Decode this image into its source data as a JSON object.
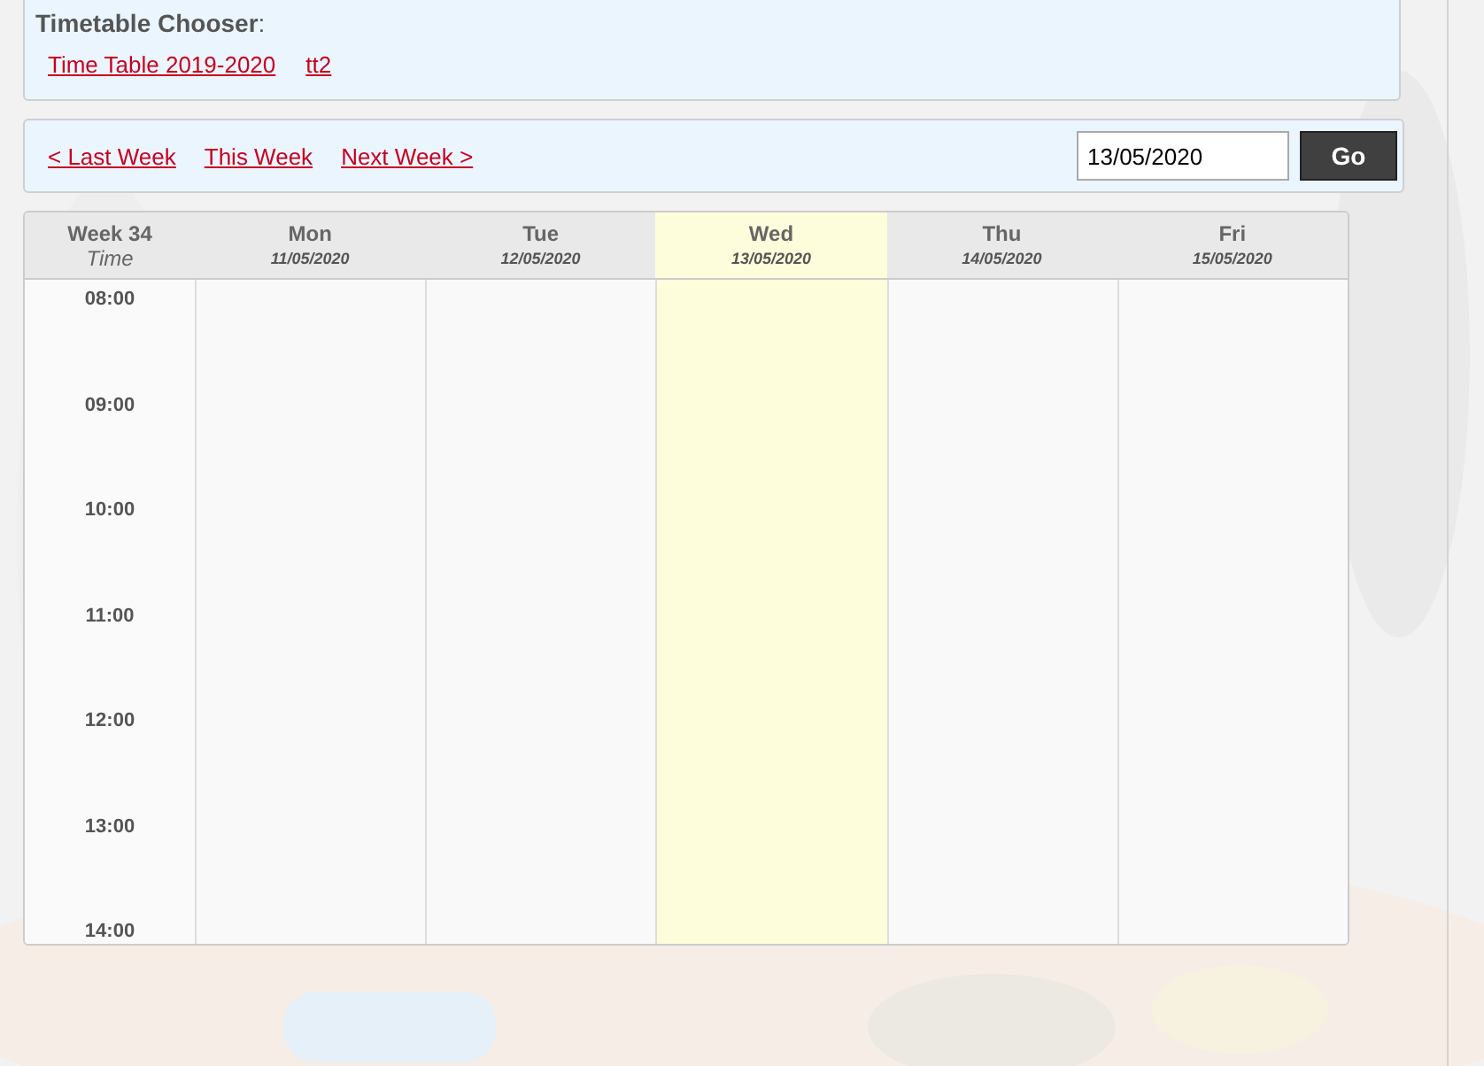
{
  "chooser": {
    "title": "Timetable Chooser",
    "suffix": ":",
    "timetables": [
      "Time Table 2019-2020",
      "tt2"
    ]
  },
  "navigation": {
    "links": [
      "< Last Week",
      "This Week",
      "Next Week >"
    ],
    "date_value": "13/05/2020",
    "go_button": "Go"
  },
  "timetable": {
    "week": "Week 34",
    "time_label": "Time",
    "days": [
      {
        "name": "Mon",
        "date": "11/05/2020",
        "selected": false
      },
      {
        "name": "Tue",
        "date": "12/05/2020",
        "selected": false
      },
      {
        "name": "Wed",
        "date": "13/05/2020",
        "selected": true
      },
      {
        "name": "Thu",
        "date": "14/05/2020",
        "selected": false
      },
      {
        "name": "Fri",
        "date": "15/05/2020",
        "selected": false
      }
    ],
    "times": [
      "08:00",
      "09:00",
      "10:00",
      "11:00",
      "12:00",
      "13:00",
      "14:00"
    ]
  }
}
